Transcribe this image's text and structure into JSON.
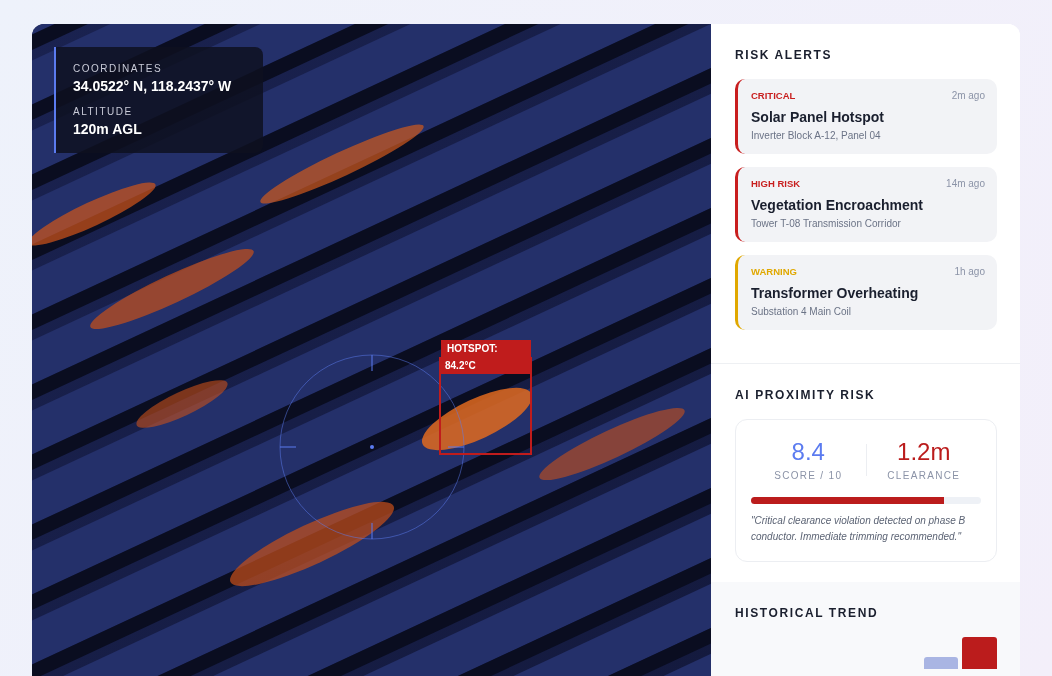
{
  "telemetry": {
    "coordinates_label": "COORDINATES",
    "coordinates": "34.0522° N, 118.2437° W",
    "altitude_label": "ALTITUDE",
    "altitude": "120m AGL"
  },
  "detection": {
    "label": "HOTSPOT:",
    "value": "84.2°C"
  },
  "risk_alerts": {
    "title": "RISK ALERTS",
    "items": [
      {
        "severity": "CRITICAL",
        "color": "#c81e1e",
        "time": "2m ago",
        "title": "Solar Panel Hotspot",
        "location": "Inverter Block A-12, Panel 04"
      },
      {
        "severity": "HIGH RISK",
        "color": "#c81e1e",
        "time": "14m ago",
        "title": "Vegetation Encroachment",
        "location": "Tower T-08 Transmission Corridor"
      },
      {
        "severity": "WARNING",
        "color": "#e0a800",
        "time": "1h ago",
        "title": "Transformer Overheating",
        "location": "Substation 4 Main Coil"
      }
    ]
  },
  "proximity": {
    "title": "AI PROXIMITY RISK",
    "score": "8.4",
    "score_label": "SCORE / 10",
    "clearance": "1.2m",
    "clearance_label": "CLEARANCE",
    "level": 0.84,
    "note": "\"Critical clearance violation detected on phase B conductor. Immediate trimming recommended.\""
  },
  "historical_trend": {
    "title": "HISTORICAL TREND"
  }
}
